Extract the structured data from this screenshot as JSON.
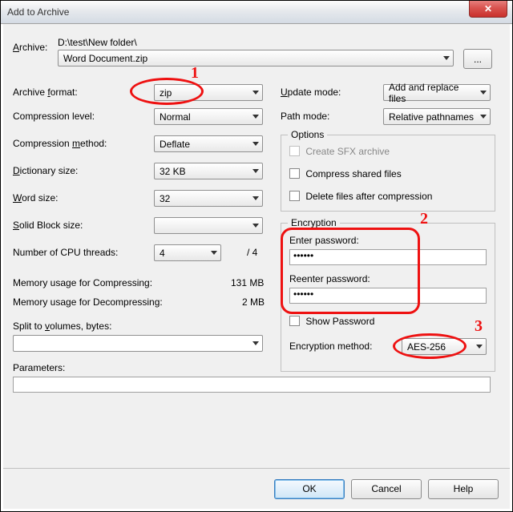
{
  "window": {
    "title": "Add to Archive"
  },
  "archive": {
    "label_prefix": "A",
    "label_rest": "rchive:",
    "path": "D:\\test\\New folder\\",
    "filename": "Word Document.zip",
    "browse_label": "..."
  },
  "left": {
    "archive_format": {
      "label": "Archive format:",
      "ul": "f",
      "value": "zip"
    },
    "compression_level": {
      "label": "Compression level:",
      "value": "Normal"
    },
    "compression_method": {
      "label": "Compression method:",
      "ul": "m",
      "value": "Deflate"
    },
    "dictionary_size": {
      "label": "Dictionary size:",
      "ul": "D",
      "value": "32 KB"
    },
    "word_size": {
      "label": "Word size:",
      "ul": "W",
      "value": "32"
    },
    "solid_block_size": {
      "label": "Solid Block size:",
      "ul": "S",
      "value": ""
    },
    "cpu_threads": {
      "label": "Number of CPU threads:",
      "value": "4",
      "total": "/ 4"
    },
    "mem_compress": {
      "label": "Memory usage for Compressing:",
      "value": "131 MB"
    },
    "mem_decompress": {
      "label": "Memory usage for Decompressing:",
      "value": "2 MB"
    },
    "split_volumes": {
      "label": "Split to volumes, bytes:",
      "ul": "v",
      "value": ""
    },
    "parameters": {
      "label": "Parameters:",
      "value": ""
    }
  },
  "right": {
    "update_mode": {
      "label": "Update mode:",
      "ul": "U",
      "value": "Add and replace files"
    },
    "path_mode": {
      "label": "Path mode:",
      "value": "Relative pathnames"
    },
    "options_legend": "Options",
    "opt_sfx": {
      "label": "Create SFX archive",
      "checked": false,
      "disabled": true
    },
    "opt_shared": {
      "label": "Compress shared files",
      "checked": false
    },
    "opt_delete": {
      "label": "Delete files after compression",
      "checked": false
    },
    "encryption_legend": "Encryption",
    "enter_pw_label": "Enter password:",
    "reenter_pw_label": "Reenter password:",
    "pw1": "••••••",
    "pw2": "••••••",
    "show_pw": {
      "label": "Show Password",
      "checked": false
    },
    "enc_method": {
      "label": "Encryption method:",
      "ul": "E",
      "value": "AES-256"
    }
  },
  "footer": {
    "ok": "OK",
    "cancel": "Cancel",
    "help": "Help"
  },
  "annotations": {
    "n1": "1",
    "n2": "2",
    "n3": "3"
  }
}
